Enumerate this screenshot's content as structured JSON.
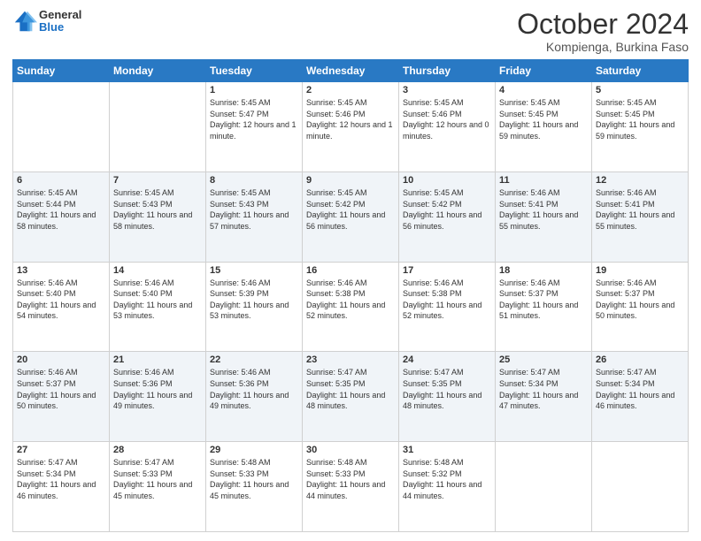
{
  "logo": {
    "general": "General",
    "blue": "Blue"
  },
  "title": "October 2024",
  "subtitle": "Kompienga, Burkina Faso",
  "days_of_week": [
    "Sunday",
    "Monday",
    "Tuesday",
    "Wednesday",
    "Thursday",
    "Friday",
    "Saturday"
  ],
  "weeks": [
    [
      {
        "day": "",
        "info": ""
      },
      {
        "day": "",
        "info": ""
      },
      {
        "day": "1",
        "info": "Sunrise: 5:45 AM\nSunset: 5:47 PM\nDaylight: 12 hours and 1 minute."
      },
      {
        "day": "2",
        "info": "Sunrise: 5:45 AM\nSunset: 5:46 PM\nDaylight: 12 hours and 1 minute."
      },
      {
        "day": "3",
        "info": "Sunrise: 5:45 AM\nSunset: 5:46 PM\nDaylight: 12 hours and 0 minutes."
      },
      {
        "day": "4",
        "info": "Sunrise: 5:45 AM\nSunset: 5:45 PM\nDaylight: 11 hours and 59 minutes."
      },
      {
        "day": "5",
        "info": "Sunrise: 5:45 AM\nSunset: 5:45 PM\nDaylight: 11 hours and 59 minutes."
      }
    ],
    [
      {
        "day": "6",
        "info": "Sunrise: 5:45 AM\nSunset: 5:44 PM\nDaylight: 11 hours and 58 minutes."
      },
      {
        "day": "7",
        "info": "Sunrise: 5:45 AM\nSunset: 5:43 PM\nDaylight: 11 hours and 58 minutes."
      },
      {
        "day": "8",
        "info": "Sunrise: 5:45 AM\nSunset: 5:43 PM\nDaylight: 11 hours and 57 minutes."
      },
      {
        "day": "9",
        "info": "Sunrise: 5:45 AM\nSunset: 5:42 PM\nDaylight: 11 hours and 56 minutes."
      },
      {
        "day": "10",
        "info": "Sunrise: 5:45 AM\nSunset: 5:42 PM\nDaylight: 11 hours and 56 minutes."
      },
      {
        "day": "11",
        "info": "Sunrise: 5:46 AM\nSunset: 5:41 PM\nDaylight: 11 hours and 55 minutes."
      },
      {
        "day": "12",
        "info": "Sunrise: 5:46 AM\nSunset: 5:41 PM\nDaylight: 11 hours and 55 minutes."
      }
    ],
    [
      {
        "day": "13",
        "info": "Sunrise: 5:46 AM\nSunset: 5:40 PM\nDaylight: 11 hours and 54 minutes."
      },
      {
        "day": "14",
        "info": "Sunrise: 5:46 AM\nSunset: 5:40 PM\nDaylight: 11 hours and 53 minutes."
      },
      {
        "day": "15",
        "info": "Sunrise: 5:46 AM\nSunset: 5:39 PM\nDaylight: 11 hours and 53 minutes."
      },
      {
        "day": "16",
        "info": "Sunrise: 5:46 AM\nSunset: 5:38 PM\nDaylight: 11 hours and 52 minutes."
      },
      {
        "day": "17",
        "info": "Sunrise: 5:46 AM\nSunset: 5:38 PM\nDaylight: 11 hours and 52 minutes."
      },
      {
        "day": "18",
        "info": "Sunrise: 5:46 AM\nSunset: 5:37 PM\nDaylight: 11 hours and 51 minutes."
      },
      {
        "day": "19",
        "info": "Sunrise: 5:46 AM\nSunset: 5:37 PM\nDaylight: 11 hours and 50 minutes."
      }
    ],
    [
      {
        "day": "20",
        "info": "Sunrise: 5:46 AM\nSunset: 5:37 PM\nDaylight: 11 hours and 50 minutes."
      },
      {
        "day": "21",
        "info": "Sunrise: 5:46 AM\nSunset: 5:36 PM\nDaylight: 11 hours and 49 minutes."
      },
      {
        "day": "22",
        "info": "Sunrise: 5:46 AM\nSunset: 5:36 PM\nDaylight: 11 hours and 49 minutes."
      },
      {
        "day": "23",
        "info": "Sunrise: 5:47 AM\nSunset: 5:35 PM\nDaylight: 11 hours and 48 minutes."
      },
      {
        "day": "24",
        "info": "Sunrise: 5:47 AM\nSunset: 5:35 PM\nDaylight: 11 hours and 48 minutes."
      },
      {
        "day": "25",
        "info": "Sunrise: 5:47 AM\nSunset: 5:34 PM\nDaylight: 11 hours and 47 minutes."
      },
      {
        "day": "26",
        "info": "Sunrise: 5:47 AM\nSunset: 5:34 PM\nDaylight: 11 hours and 46 minutes."
      }
    ],
    [
      {
        "day": "27",
        "info": "Sunrise: 5:47 AM\nSunset: 5:34 PM\nDaylight: 11 hours and 46 minutes."
      },
      {
        "day": "28",
        "info": "Sunrise: 5:47 AM\nSunset: 5:33 PM\nDaylight: 11 hours and 45 minutes."
      },
      {
        "day": "29",
        "info": "Sunrise: 5:48 AM\nSunset: 5:33 PM\nDaylight: 11 hours and 45 minutes."
      },
      {
        "day": "30",
        "info": "Sunrise: 5:48 AM\nSunset: 5:33 PM\nDaylight: 11 hours and 44 minutes."
      },
      {
        "day": "31",
        "info": "Sunrise: 5:48 AM\nSunset: 5:32 PM\nDaylight: 11 hours and 44 minutes."
      },
      {
        "day": "",
        "info": ""
      },
      {
        "day": "",
        "info": ""
      }
    ]
  ]
}
